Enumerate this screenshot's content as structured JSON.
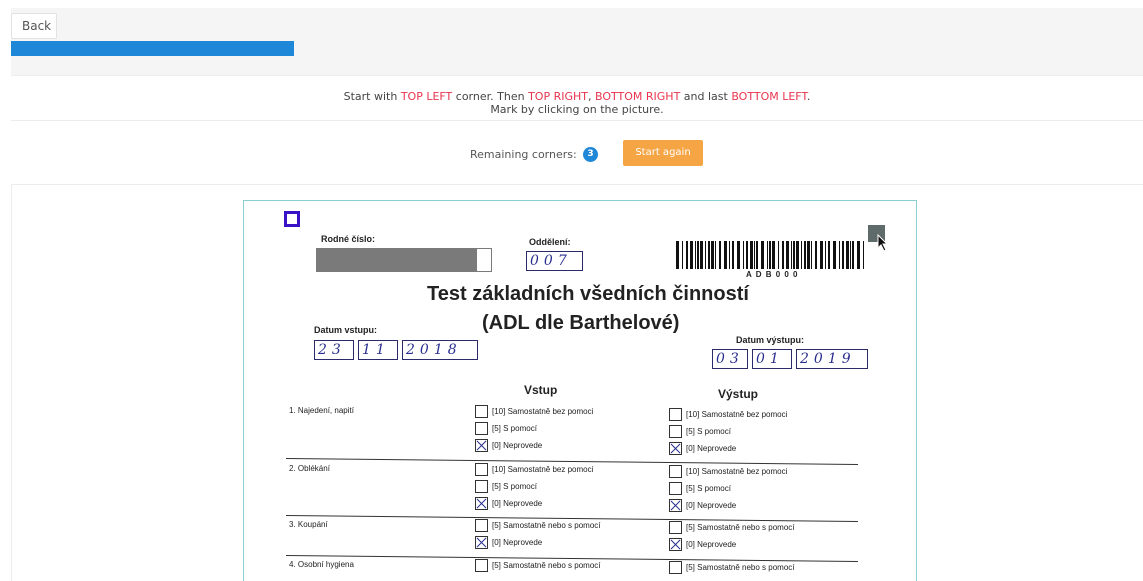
{
  "back_label": "Back",
  "progress_fraction": 0.25,
  "instructions": {
    "t1": "Start with ",
    "c1": "TOP LEFT",
    "t2": " corner. Then ",
    "c2": "TOP RIGHT",
    "t3": ", ",
    "c3": "BOTTOM RIGHT",
    "t4": " and last ",
    "c4": "BOTTOM LEFT",
    "t5": ".",
    "line2": "Mark by clicking on the picture."
  },
  "remaining_label": "Remaining corners:",
  "remaining_count": "3",
  "start_again_label": "Start again",
  "colors": {
    "accent": "#1e87d8",
    "highlight": "#e8344e",
    "start_again": "#f6a545",
    "corner_marker": "#3a13c8"
  },
  "document": {
    "rodne_cislo_label": "Rodné číslo:",
    "oddeleni_label": "Oddělení:",
    "oddeleni_value": "007",
    "barcode_code": "A D B 0 0 0",
    "title_line1": "Test základních všedních činností",
    "title_line2": "(ADL dle Barthelové)",
    "datum_vstupu_label": "Datum vstupu:",
    "datum_vstupu_value": [
      "23",
      "11",
      "2018"
    ],
    "datum_vystupu_label": "Datum výstupu:",
    "datum_vystupu_value": [
      "03",
      "01",
      "2019"
    ],
    "vstup_header": "Vstup",
    "vystup_header": "Výstup",
    "rows": [
      {
        "label": "1. Najedení, napití",
        "options_vstup": [
          "[10] Samostatně bez pomoci",
          "[5] S pomocí",
          "[0] Neprovede"
        ],
        "options_vystup": [
          "[10] Samostatně bez pomoci",
          "[5] S pomocí",
          "[0] Neprovede"
        ]
      },
      {
        "label": "2. Oblékání",
        "options_vstup": [
          "[10] Samostatně bez pomoci",
          "[5] S pomocí",
          "[0] Neprovede"
        ],
        "options_vystup": [
          "[10] Samostatně bez pomoci",
          "[5] S pomocí",
          "[0] Neprovede"
        ]
      },
      {
        "label": "3. Koupání",
        "options_vstup": [
          "[5] Samostatně nebo s pomocí",
          "[0] Neprovede"
        ],
        "options_vystup": [
          "[5] Samostatně nebo s pomocí",
          "[0] Neprovede"
        ]
      },
      {
        "label": "4. Osobní hygiena",
        "options_vstup": [
          "[5] Samostatně nebo s pomocí"
        ],
        "options_vystup": [
          "[5] Samostatně nebo s pomocí"
        ]
      }
    ]
  }
}
